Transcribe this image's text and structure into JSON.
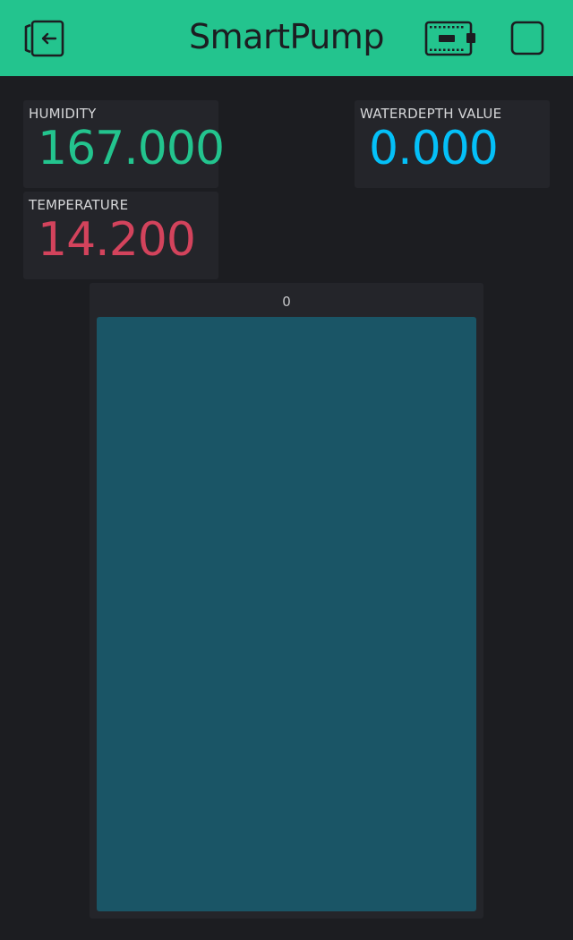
{
  "app": {
    "title": "SmartPump",
    "accent_color": "#23c48e",
    "background_color": "#1c1d21",
    "icons": {
      "exit": "exit-icon",
      "device": "device-board-icon",
      "stop": "stop-square-icon"
    }
  },
  "widgets": {
    "humidity": {
      "label": "HUMIDITY",
      "value": "167.000",
      "color": "#23c48e"
    },
    "waterdepth": {
      "label": "WATERDEPTH VALUE",
      "value": "0.000",
      "color": "#04c0f8"
    },
    "temperature": {
      "label": "TEMPERATURE",
      "value": "14.200",
      "color": "#d3435c"
    },
    "slider": {
      "value_label": "0",
      "level": 0,
      "track_color": "#1a5566",
      "fill_color": "#04c0f8"
    }
  }
}
